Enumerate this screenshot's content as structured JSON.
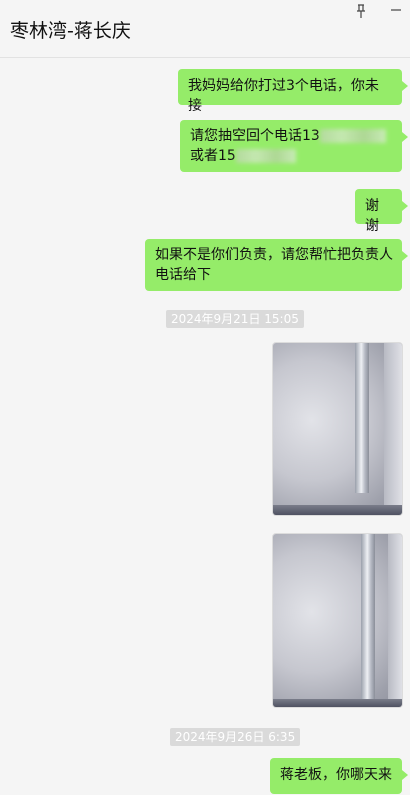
{
  "window": {
    "title": "枣林湾-蒋长庆"
  },
  "icons": {
    "pin": "pin-icon",
    "minimize": "minimize-icon"
  },
  "messages": [
    {
      "type": "text",
      "text": "我妈妈给你打过3个电话，你未接"
    },
    {
      "type": "text",
      "line1": "请您抽空回个电话13",
      "line2": "或者15"
    },
    {
      "type": "text",
      "text": "谢谢"
    },
    {
      "type": "text",
      "line1": "如果不是你们负责，请您帮忙把负责人",
      "line2": "电话给下"
    },
    {
      "type": "timestamp",
      "text": "2024年9月21日 15:05"
    },
    {
      "type": "image",
      "alt": "photo-wall-pipe"
    },
    {
      "type": "image",
      "alt": "photo-wall-pipe"
    },
    {
      "type": "timestamp",
      "text": "2024年9月26日 6:35"
    },
    {
      "type": "text",
      "text": "蒋老板，你哪天来"
    }
  ],
  "colors": {
    "bubble_outgoing": "#95ec69",
    "background": "#f5f5f5",
    "timestamp_bg": "#dadada"
  }
}
